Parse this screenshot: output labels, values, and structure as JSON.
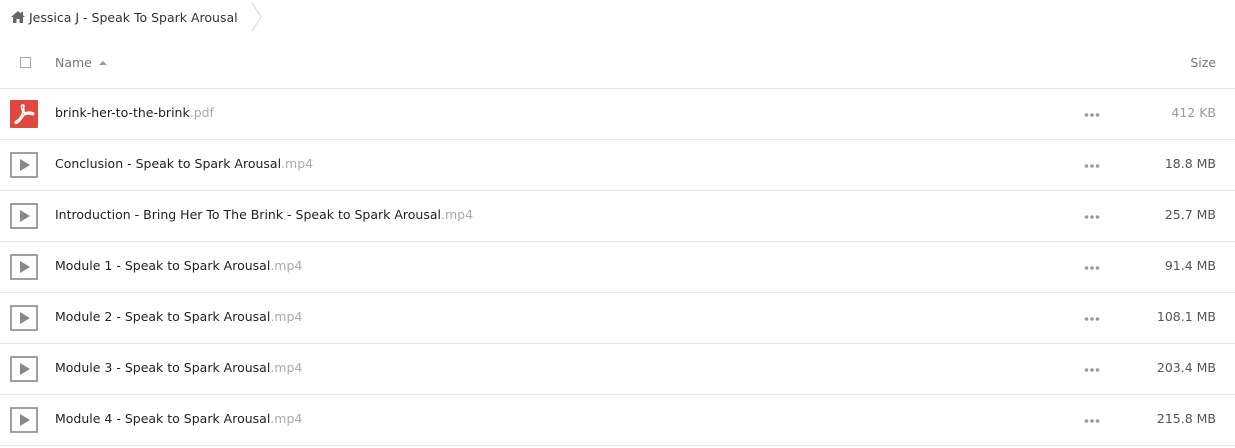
{
  "breadcrumb": {
    "home_icon": "home-icon",
    "current_folder": "Jessica J - Speak To Spark Arousal",
    "separator_icon": "chevron-right-icon"
  },
  "header": {
    "name_label": "Name",
    "size_label": "Size",
    "sort_icon": "sort-ascending-icon"
  },
  "files": [
    {
      "name": "brink-her-to-the-brink",
      "ext": ".pdf",
      "size": "412 KB",
      "icon": "pdf-icon"
    },
    {
      "name": "Conclusion - Speak to Spark Arousal",
      "ext": ".mp4",
      "size": "18.8 MB",
      "icon": "video-play-icon"
    },
    {
      "name": "Introduction - Bring Her To The Brink - Speak to Spark Arousal",
      "ext": ".mp4",
      "size": "25.7 MB",
      "icon": "video-play-icon"
    },
    {
      "name": "Module 1 - Speak to Spark Arousal",
      "ext": ".mp4",
      "size": "91.4 MB",
      "icon": "video-play-icon"
    },
    {
      "name": "Module 2 - Speak to Spark Arousal",
      "ext": ".mp4",
      "size": "108.1 MB",
      "icon": "video-play-icon"
    },
    {
      "name": "Module 3 - Speak to Spark Arousal",
      "ext": ".mp4",
      "size": "203.4 MB",
      "icon": "video-play-icon"
    },
    {
      "name": "Module 4 - Speak to Spark Arousal",
      "ext": ".mp4",
      "size": "215.8 MB",
      "icon": "video-play-icon"
    }
  ],
  "colors": {
    "pdf_red": "#e0473e",
    "video_icon_gray": "#888888",
    "extension_gray": "#aaaaaa",
    "divider": "#e6e6e6"
  }
}
